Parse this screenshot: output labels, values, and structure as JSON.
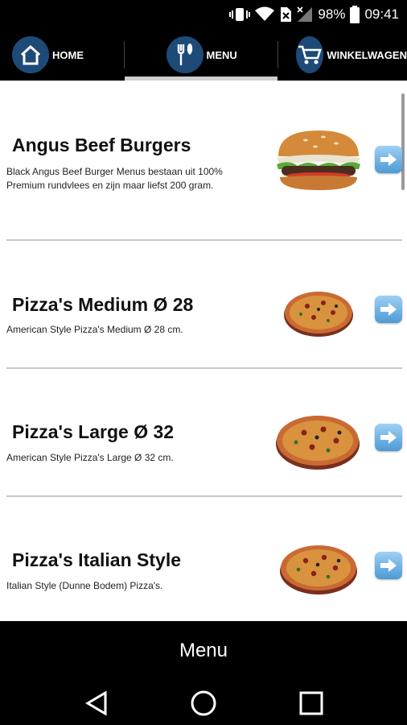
{
  "status_bar": {
    "battery": "98%",
    "time": "09:41",
    "icons": [
      "vibrate-icon",
      "wifi-icon",
      "nosim-icon",
      "signal-icon",
      "battery-icon"
    ]
  },
  "nav": {
    "home": {
      "label": "HOME",
      "icon": "home-icon"
    },
    "menu": {
      "label": "MENU",
      "icon": "cutlery-icon",
      "active": true
    },
    "cart": {
      "label": "WINKELWAGEN",
      "icon": "cart-icon"
    }
  },
  "items": [
    {
      "title": "Angus Beef Burgers",
      "description": "Black Angus Beef Burger Menus bestaan uit 100% Premium rundvlees en zijn maar liefst 200 gram.",
      "image": "burger"
    },
    {
      "title": "Pizza's Medium Ø 28",
      "description": "American Style Pizza's Medium Ø 28 cm.",
      "image": "pizza"
    },
    {
      "title": "Pizza's Large Ø 32",
      "description": "American Style Pizza's Large Ø 32 cm.",
      "image": "pizza"
    },
    {
      "title": "Pizza's Italian Style",
      "description": "Italian Style (Dunne Bodem) Pizza's.",
      "image": "pizza"
    }
  ],
  "bottom_bar": {
    "title": "Menu"
  },
  "colors": {
    "accent": "#1e4a78",
    "arrow": "#5aa7e0",
    "background": "#ffffff"
  }
}
